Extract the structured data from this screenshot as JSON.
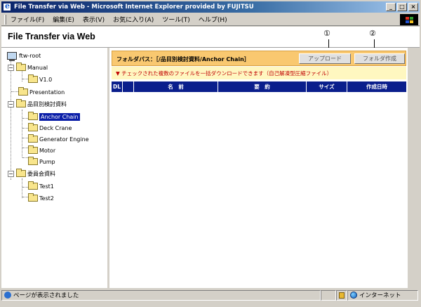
{
  "window": {
    "title": "File Transfer via Web - Microsoft Internet Explorer provided by FUJITSU",
    "controls": [
      "_",
      "□",
      "×"
    ]
  },
  "menu": [
    "ファイル(F)",
    "編集(E)",
    "表示(V)",
    "お気に入り(A)",
    "ツール(T)",
    "ヘルプ(H)"
  ],
  "header": {
    "app_title": "File Transfer via Web",
    "callout_1": "①",
    "callout_2": "②"
  },
  "tree": {
    "root": "ftw-root",
    "items": [
      {
        "label": "Manual",
        "expander": "−"
      },
      {
        "label": "V1.0"
      },
      {
        "label": "Presentation"
      },
      {
        "label": "品目別検討資料",
        "expander": "−"
      },
      {
        "label": "Anchor Chain",
        "selected": true
      },
      {
        "label": "Deck Crane"
      },
      {
        "label": "Generator Engine"
      },
      {
        "label": "Motor"
      },
      {
        "label": "Pump"
      },
      {
        "label": "委員会資料",
        "expander": "−"
      },
      {
        "label": "Test1"
      },
      {
        "label": "Test2"
      }
    ]
  },
  "main": {
    "folder_path": "フォルダパス：［/品目別検討資料/Anchor Chain］",
    "upload_button": "アップロード",
    "create_folder_button": "フォルダ作成",
    "note": "▼ チェックされた複数のファイルを一括ダウンロードできます（自己解凍型圧縮ファイル）",
    "columns": [
      "DL",
      "",
      "名　前",
      "要　約",
      "サイズ",
      "作成日時"
    ]
  },
  "status": {
    "text": "ページが表示されました",
    "zone": "インターネット"
  },
  "colors": {
    "path_bar": "#f9c870",
    "note_bar": "#fff7c0",
    "table_header": "#0a1e8c",
    "selection": "#0a1ea8"
  }
}
